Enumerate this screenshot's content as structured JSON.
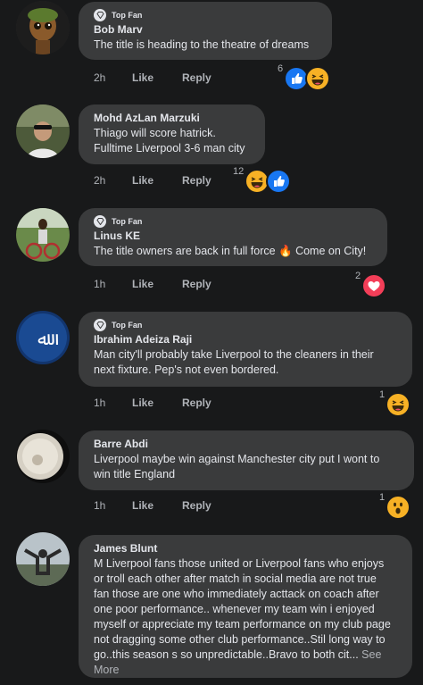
{
  "labels": {
    "top_fan": "Top Fan",
    "like": "Like",
    "reply": "Reply"
  },
  "comments": [
    {
      "name": "Bob Marv",
      "top_fan": true,
      "lines": [
        "The title is heading to the theatre of dreams"
      ],
      "time": "2h",
      "reaction_count": "6",
      "reactions": [
        "like-icon",
        "haha-icon"
      ]
    },
    {
      "name": "Mohd AzLan Marzuki",
      "top_fan": false,
      "lines": [
        "Thiago will score hatrick.",
        "Fulltime Liverpool 3-6 man city"
      ],
      "time": "2h",
      "reaction_count": "12",
      "reactions": [
        "haha-icon",
        "like-icon"
      ]
    },
    {
      "name": "Linus KE",
      "top_fan": true,
      "lines": [
        "The title owners are back in full force 🔥 Come on City!"
      ],
      "time": "1h",
      "reaction_count": "2",
      "reactions": [
        "love-icon"
      ]
    },
    {
      "name": "Ibrahim Adeiza Raji",
      "top_fan": true,
      "lines": [
        "Man city'll probably take Liverpool to the cleaners in their",
        "next fixture. Pep's not even bordered."
      ],
      "time": "1h",
      "reaction_count": "1",
      "reactions": [
        "haha-icon"
      ]
    },
    {
      "name": "Barre Abdi",
      "top_fan": false,
      "lines": [
        "Liverpool  maybe win against Manchester city put I wont to",
        "win title England"
      ],
      "time": "1h",
      "reaction_count": "1",
      "reactions": [
        "wow-icon"
      ]
    },
    {
      "name": "James Blunt",
      "top_fan": false,
      "lines": [
        "M Liverpool fans those united or Liverpool fans who enjoys",
        "or troll each other after match in social media are not true",
        "fan those are one who immediately acttack on coach after",
        "one poor performance.. whenever my team win i enjoyed",
        "myself or appreciate my team performance on my club page",
        "not dragging some other club performance..Stil long way to"
      ],
      "last_line": "go..this season s so unpredictable..Bravo to both cit...",
      "see_more": " See More"
    }
  ]
}
